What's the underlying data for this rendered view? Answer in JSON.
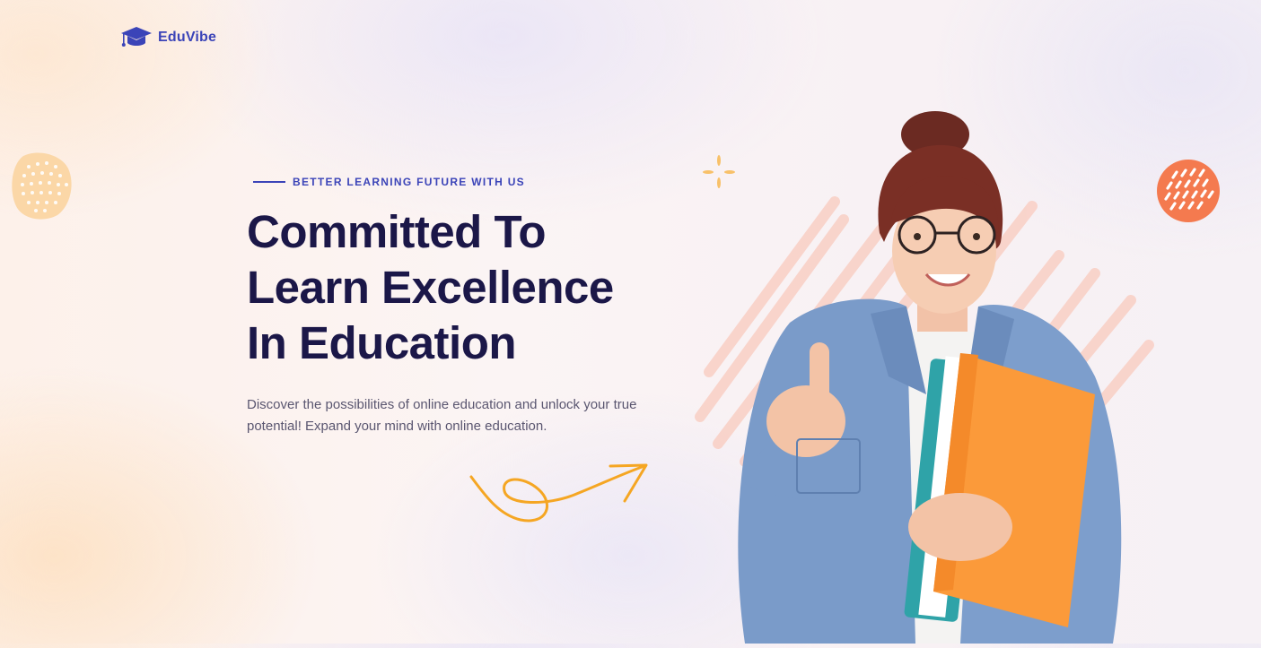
{
  "brand": {
    "name": "EduVibe",
    "logo_icon": "graduation-cap-icon",
    "color": "#3b44b8"
  },
  "hero": {
    "eyebrow": "BETTER LEARNING FUTURE WITH US",
    "headline_lines": [
      "Committed To",
      "Learn Excellence",
      "In Education"
    ],
    "description": "Discover the possibilities of online education and unlock your true potential! Expand your mind with online education."
  },
  "decor": {
    "accent_orange": "#f5a623",
    "accent_coral": "#f47a4f",
    "accent_peach": "#fbd7a7",
    "heading_color": "#1b1748"
  },
  "image": {
    "subject": "student-thumbs-up"
  }
}
